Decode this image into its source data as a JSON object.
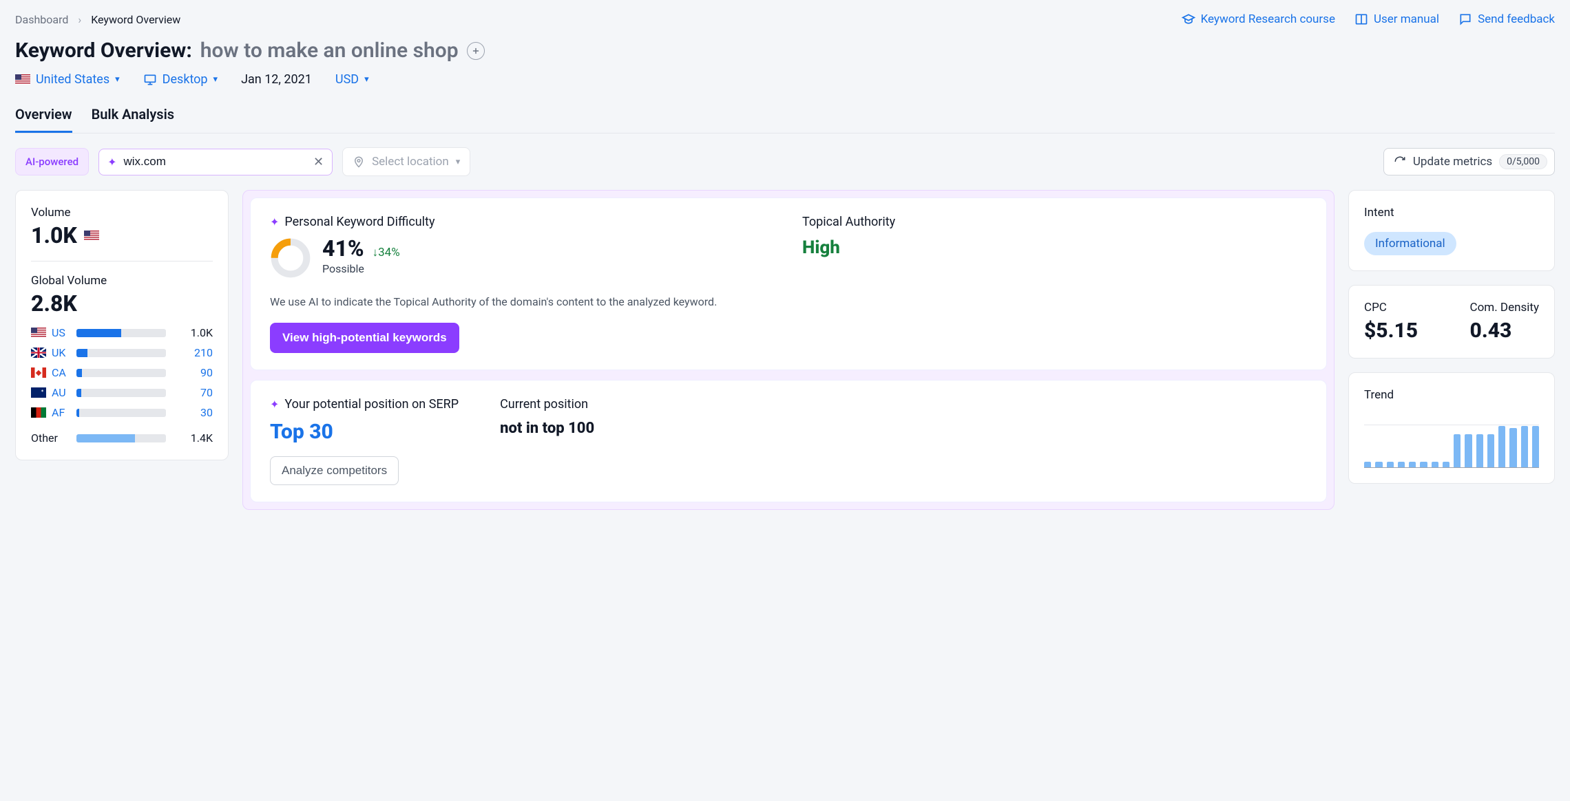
{
  "breadcrumb": {
    "root": "Dashboard",
    "current": "Keyword Overview"
  },
  "topLinks": {
    "course": "Keyword Research course",
    "manual": "User manual",
    "feedback": "Send feedback"
  },
  "title": {
    "label": "Keyword Overview:",
    "keyword": "how to make an online shop"
  },
  "filters": {
    "country": "United States",
    "device": "Desktop",
    "date": "Jan 12, 2021",
    "currency": "USD"
  },
  "tabs": {
    "overview": "Overview",
    "bulk": "Bulk Analysis"
  },
  "toolbar": {
    "aiBadge": "AI-powered",
    "domainValue": "wix.com",
    "locationPlaceholder": "Select location",
    "updateLabel": "Update metrics",
    "quota": "0/5,000"
  },
  "volume": {
    "title": "Volume",
    "value": "1.0K",
    "globalTitle": "Global Volume",
    "globalValue": "2.8K",
    "rows": [
      {
        "cc": "US",
        "pct": 50,
        "val": "1.0K",
        "link": false
      },
      {
        "cc": "UK",
        "pct": 12,
        "val": "210",
        "link": true
      },
      {
        "cc": "CA",
        "pct": 6,
        "val": "90",
        "link": true
      },
      {
        "cc": "AU",
        "pct": 5,
        "val": "70",
        "link": true
      },
      {
        "cc": "AF",
        "pct": 3,
        "val": "30",
        "link": true
      }
    ],
    "otherLabel": "Other",
    "otherPct": 65,
    "otherVal": "1.4K"
  },
  "pkd": {
    "title": "Personal Keyword Difficulty",
    "pct": "41%",
    "delta": "34%",
    "sub": "Possible",
    "taTitle": "Topical Authority",
    "taValue": "High",
    "desc": "We use AI to indicate the Topical Authority of the domain's content to the analyzed keyword.",
    "cta": "View high-potential keywords"
  },
  "serp": {
    "potTitle": "Your potential position on SERP",
    "potValue": "Top 30",
    "curTitle": "Current position",
    "curValue": "not in top 100",
    "cta": "Analyze competitors"
  },
  "intent": {
    "title": "Intent",
    "value": "Informational"
  },
  "cpc": {
    "title": "CPC",
    "value": "$5.15",
    "cdTitle": "Com. Density",
    "cdValue": "0.43"
  },
  "trend": {
    "title": "Trend",
    "bars": [
      10,
      10,
      10,
      10,
      10,
      10,
      10,
      10,
      55,
      55,
      55,
      55,
      68,
      65,
      68,
      68
    ]
  }
}
